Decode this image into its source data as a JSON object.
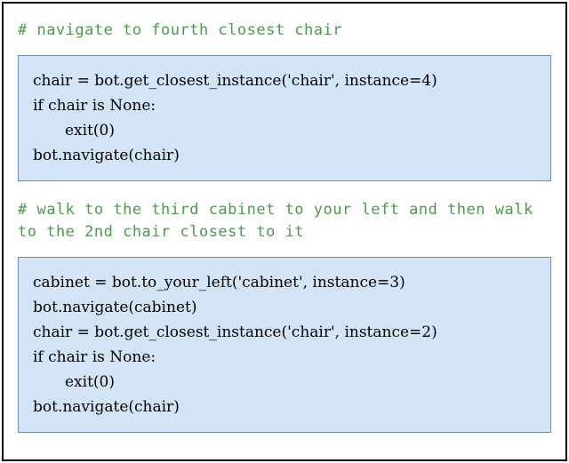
{
  "section1": {
    "comment": "# navigate to fourth closest chair",
    "code_lines": [
      "chair = bot.get_closest_instance('chair', instance=4)",
      "if chair is None:",
      "    exit(0)",
      "bot.navigate(chair)"
    ]
  },
  "section2": {
    "comment": "# walk to the third cabinet to your left and then walk to the 2nd chair closest to it",
    "code_lines": [
      "cabinet = bot.to_your_left('cabinet', instance=3)",
      "bot.navigate(cabinet)",
      "chair = bot.get_closest_instance('chair', instance=2)",
      "if chair is None:",
      "    exit(0)",
      "bot.navigate(chair)"
    ]
  }
}
